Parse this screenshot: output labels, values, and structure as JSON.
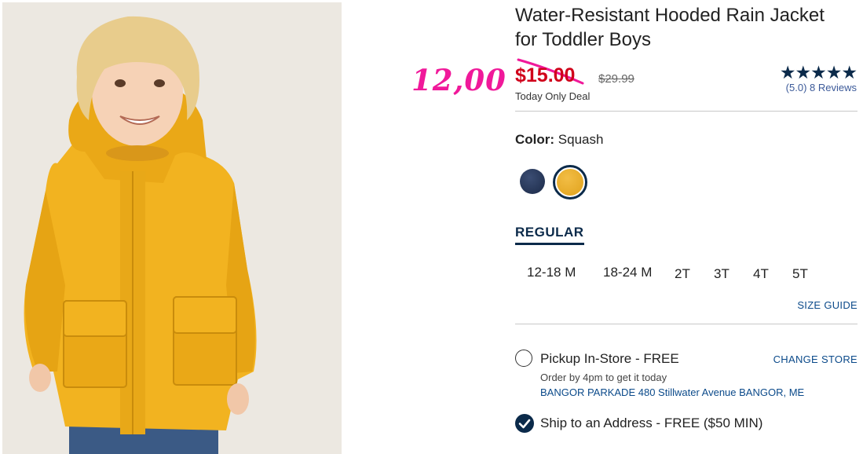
{
  "product": {
    "title_line1": "Water-Resistant Hooded Rain Jacket",
    "title_line2": "for Toddler Boys",
    "sale_price": "$15.00",
    "original_price": "$29.99",
    "deal_text": "Today Only Deal",
    "handwritten_price": "12,00",
    "rating": {
      "stars": "★★★★★",
      "value": "(5.0)",
      "reviews": "8 Reviews"
    }
  },
  "color": {
    "label": "Color:",
    "selected": "Squash",
    "swatches": [
      "navy",
      "squash"
    ]
  },
  "fit_tab": "REGULAR",
  "sizes": [
    "12-18 M",
    "18-24 M",
    "2T",
    "3T",
    "4T",
    "5T"
  ],
  "size_guide": "SIZE GUIDE",
  "fulfillment": {
    "pickup_label": "Pickup In-Store - FREE",
    "pickup_sub": "Order by 4pm to get it today",
    "store_address": "BANGOR PARKADE 480 Stillwater Avenue  BANGOR, ME",
    "change_store": "CHANGE STORE",
    "ship_label": "Ship to an Address - FREE ($50 MIN)"
  },
  "colors": {
    "sale_red": "#d0021b",
    "navy": "#0b2a4a",
    "link_blue": "#0b4a8a",
    "annotation_pink": "#f0199a",
    "jacket_yellow": "#f2b320"
  }
}
